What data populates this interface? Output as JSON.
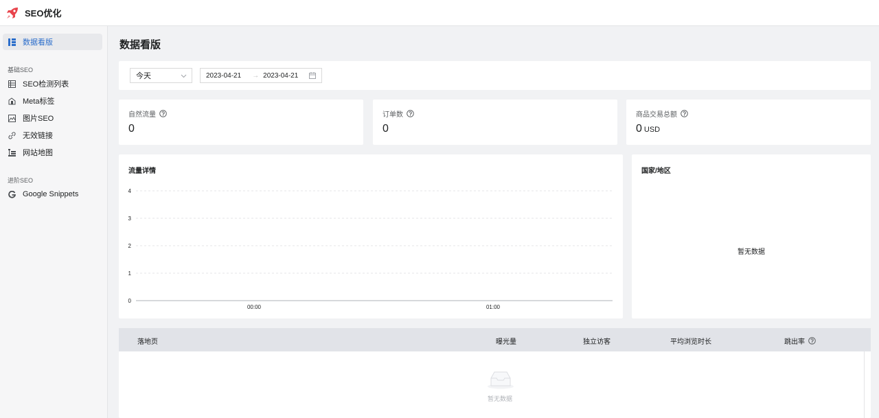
{
  "app": {
    "title": "SEO优化",
    "logo_icon": "rocket-icon",
    "accent": "#2c6ecb",
    "logo_color": "#e8434b"
  },
  "sidebar": {
    "top_item": {
      "label": "数据看版",
      "icon": "dashboard-icon"
    },
    "section_basic": "基础SEO",
    "basic_items": [
      {
        "label": "SEO检测列表",
        "icon": "list-icon"
      },
      {
        "label": "Meta标签",
        "icon": "tag-icon"
      },
      {
        "label": "图片SEO",
        "icon": "image-icon"
      },
      {
        "label": "无效链接",
        "icon": "link-icon"
      },
      {
        "label": "网站地图",
        "icon": "sitemap-icon"
      }
    ],
    "section_advanced": "进阶SEO",
    "advanced_items": [
      {
        "label": "Google Snippets",
        "icon": "google-icon"
      }
    ]
  },
  "main": {
    "title": "数据看版",
    "filter": {
      "period": "今天",
      "start_date": "2023-04-21",
      "separator": "→",
      "end_date": "2023-04-21"
    },
    "stats": [
      {
        "label": "自然流量",
        "value": "0",
        "unit": ""
      },
      {
        "label": "订单数",
        "value": "0",
        "unit": ""
      },
      {
        "label": "商品交易总额",
        "value": "0",
        "unit": "USD"
      }
    ],
    "traffic_title": "流量详情",
    "country_title": "国家/地区",
    "country_empty": "暂无数据",
    "table": {
      "columns": [
        "落地页",
        "曝光量",
        "独立访客",
        "平均浏览时长",
        "跳出率"
      ],
      "empty": "暂无数据"
    }
  },
  "chart_data": {
    "type": "line",
    "title": "流量详情",
    "x": [
      "00:00",
      "01:00"
    ],
    "series": [
      {
        "values": [
          0,
          0
        ]
      }
    ],
    "y_ticks": [
      0,
      1,
      2,
      3,
      4
    ],
    "ylim": [
      0,
      4
    ],
    "grid": true,
    "xlabel": "",
    "ylabel": ""
  }
}
